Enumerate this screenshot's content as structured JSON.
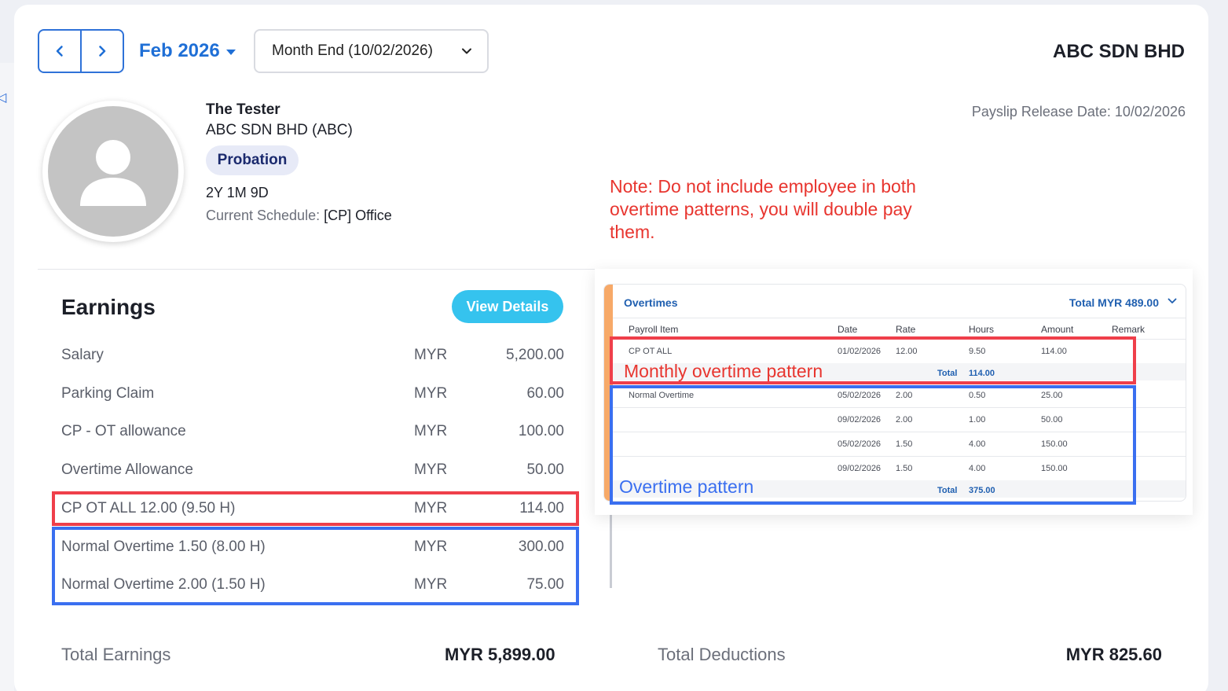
{
  "header": {
    "month": "Feb 2026",
    "period": "Month End (10/02/2026)",
    "company": "ABC SDN BHD"
  },
  "employee": {
    "name": "The Tester",
    "company": "ABC SDN BHD (ABC)",
    "status": "Probation",
    "tenure": "2Y 1M 9D",
    "schedule_label": "Current Schedule:",
    "schedule_value": "[CP] Office",
    "release_date": "Payslip Release Date: 10/02/2026"
  },
  "note": "Note: Do not include employee in both overtime patterns, you will double pay them.",
  "earnings": {
    "title": "Earnings",
    "view_details": "View Details",
    "rows": [
      {
        "label": "Salary",
        "currency": "MYR",
        "amount": "5,200.00"
      },
      {
        "label": "Parking Claim",
        "currency": "MYR",
        "amount": "60.00"
      },
      {
        "label": "CP - OT allowance",
        "currency": "MYR",
        "amount": "100.00"
      },
      {
        "label": "Overtime Allowance",
        "currency": "MYR",
        "amount": "50.00"
      },
      {
        "label": "CP OT ALL 12.00 (9.50 H)",
        "currency": "MYR",
        "amount": "114.00"
      },
      {
        "label": "Normal Overtime 1.50 (8.00 H)",
        "currency": "MYR",
        "amount": "300.00"
      },
      {
        "label": "Normal Overtime 2.00 (1.50 H)",
        "currency": "MYR",
        "amount": "75.00"
      }
    ],
    "total_label": "Total Earnings",
    "total_value": "MYR 5,899.00"
  },
  "deductions": {
    "total_label": "Total Deductions",
    "total_value": "MYR 825.60"
  },
  "overtimes": {
    "title": "Overtimes",
    "total": "Total MYR 489.00",
    "columns": [
      "Payroll Item",
      "Date",
      "Rate",
      "Hours",
      "Amount",
      "Remark"
    ],
    "group1": {
      "rows": [
        {
          "item": "CP OT ALL",
          "date": "01/02/2026",
          "rate": "12.00",
          "hours": "9.50",
          "amount": "114.00"
        }
      ],
      "total_label": "Total",
      "total_value": "114.00"
    },
    "group2": {
      "rows": [
        {
          "item": "Normal Overtime",
          "date": "05/02/2026",
          "rate": "2.00",
          "hours": "0.50",
          "amount": "25.00"
        },
        {
          "item": "",
          "date": "09/02/2026",
          "rate": "2.00",
          "hours": "1.00",
          "amount": "50.00"
        },
        {
          "item": "",
          "date": "05/02/2026",
          "rate": "1.50",
          "hours": "4.00",
          "amount": "150.00"
        },
        {
          "item": "",
          "date": "09/02/2026",
          "rate": "1.50",
          "hours": "4.00",
          "amount": "150.00"
        }
      ],
      "total_label": "Total",
      "total_value": "375.00"
    }
  },
  "annotations": {
    "monthly_pattern": "Monthly overtime pattern",
    "overtime_pattern": "Overtime pattern"
  }
}
